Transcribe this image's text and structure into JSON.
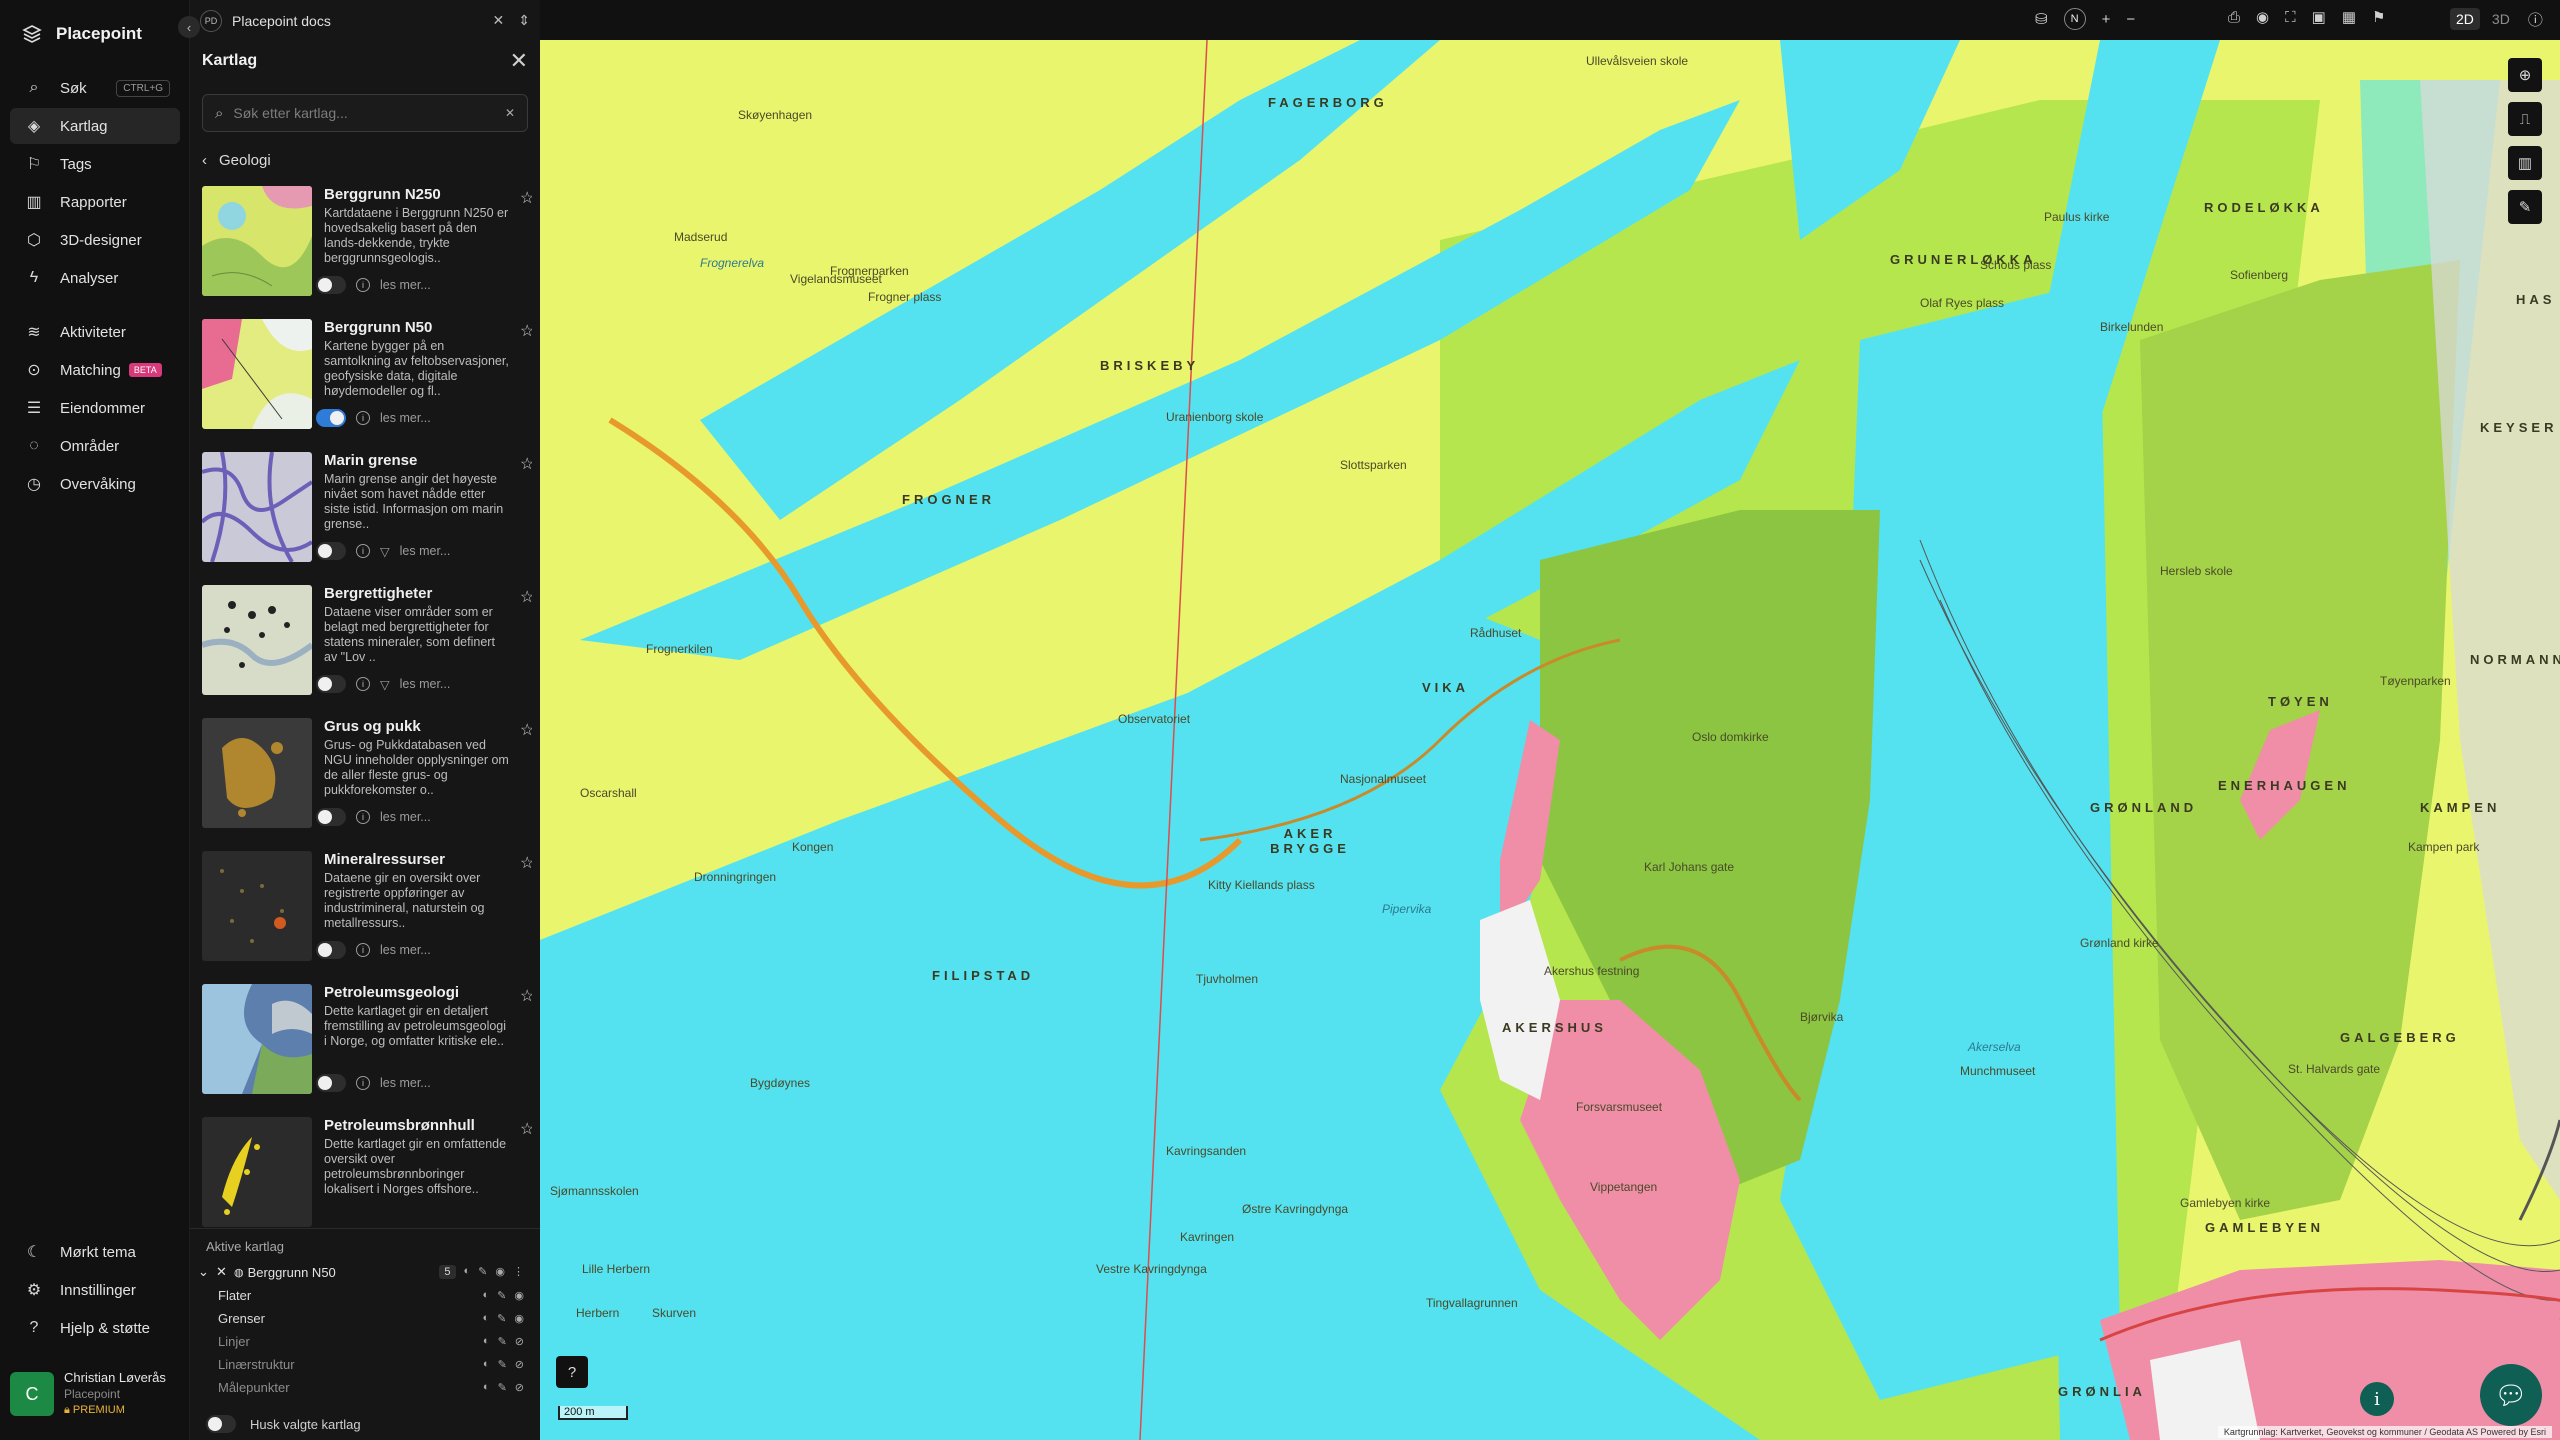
{
  "app": {
    "name": "Placepoint",
    "doc_badge": "PD",
    "doc_title": "Placepoint docs"
  },
  "nav": {
    "items": [
      {
        "label": "Søk",
        "icon": "search-icon",
        "shortcut": "CTRL+G"
      },
      {
        "label": "Kartlag",
        "icon": "layers-icon",
        "active": true
      },
      {
        "label": "Tags",
        "icon": "bookmark-icon"
      },
      {
        "label": "Rapporter",
        "icon": "chart-icon"
      },
      {
        "label": "3D-designer",
        "icon": "cube-icon"
      },
      {
        "label": "Analyser",
        "icon": "bolt-icon"
      },
      {
        "label": "Aktiviteter",
        "icon": "layers-stack-icon"
      },
      {
        "label": "Matching",
        "icon": "search-zoom-icon",
        "badge": "BETA"
      },
      {
        "label": "Eiendommer",
        "icon": "list-icon"
      },
      {
        "label": "Områder",
        "icon": "area-icon"
      },
      {
        "label": "Overvåking",
        "icon": "clock-icon"
      }
    ],
    "bottom": [
      {
        "label": "Mørkt tema",
        "icon": "moon-icon"
      },
      {
        "label": "Innstillinger",
        "icon": "gear-icon"
      },
      {
        "label": "Hjelp & støtte",
        "icon": "help-icon"
      }
    ],
    "user": {
      "initial": "C",
      "name": "Christian Løverås",
      "org": "Placepoint",
      "plan": "PREMIUM"
    }
  },
  "panel": {
    "title": "Kartlag",
    "search_placeholder": "Søk etter kartlag...",
    "breadcrumb": "Geologi",
    "read_more": "les mer...",
    "layers": [
      {
        "name": "Berggrunn N250",
        "desc": "Kartdataene i Berggrunn N250 er hovedsakelig basert på den lands-dekkende, trykte berggrunnsgeologis..",
        "on": false,
        "filter": false
      },
      {
        "name": "Berggrunn N50",
        "desc": "Kartene bygger på en samtolkning av feltobservasjoner, geofysiske data, digitale høydemodeller og fl..",
        "on": true,
        "filter": false
      },
      {
        "name": "Marin grense",
        "desc": "Marin grense angir det høyeste nivået som havet nådde etter siste istid. Informasjon om marin grense..",
        "on": false,
        "filter": true
      },
      {
        "name": "Bergrettigheter",
        "desc": "Dataene viser områder som er belagt med bergrettigheter for statens mineraler, som definert av \"Lov ..",
        "on": false,
        "filter": true
      },
      {
        "name": "Grus og pukk",
        "desc": "Grus- og Pukkdatabasen ved NGU inneholder opplysninger om de aller fleste grus- og pukkforekomster o..",
        "on": false,
        "filter": false
      },
      {
        "name": "Mineralressurser",
        "desc": "Dataene gir en oversikt over registrerte oppføringer av industrimineral, naturstein og metallressurs..",
        "on": false,
        "filter": false
      },
      {
        "name": "Petroleumsgeologi",
        "desc": "Dette kartlaget gir en detaljert fremstilling av petroleumsgeologi i Norge, og omfatter kritiske ele..",
        "on": false,
        "filter": false
      },
      {
        "name": "Petroleumsbrønnhull",
        "desc": "Dette kartlaget gir en omfattende oversikt over petroleumsbrønnboringer lokalisert i Norges offshore..",
        "on": false,
        "filter": false
      }
    ],
    "active": {
      "title": "Aktive kartlag",
      "layer_name": "Berggrunn N50",
      "count": "5",
      "sublayers": [
        {
          "name": "Flater",
          "visible": true
        },
        {
          "name": "Grenser",
          "visible": true
        },
        {
          "name": "Linjer",
          "visible": false
        },
        {
          "name": "Linærstruktur",
          "visible": false
        },
        {
          "name": "Målepunkter",
          "visible": false
        }
      ],
      "remember_label": "Husk valgte kartlag"
    }
  },
  "toolbar": {
    "compass": "N",
    "mode_2d": "2D",
    "mode_3d": "3D"
  },
  "map": {
    "scale": "200 m",
    "attribution": "Kartgrunnlag: Kartverket, Geovekst og kommuner / Geodata AS Powered by Esri",
    "districts": [
      "FAGERBORG",
      "BRISKEBY",
      "FROGNER",
      "AKER BRYGGE",
      "FILIPSTAD",
      "AKERSHUS",
      "GRUNERLØKKA",
      "RODELØKKA",
      "TØYEN",
      "ENERHAUGEN",
      "GRØNLAND",
      "GALGEBERG",
      "GAMLEBYEN",
      "KAMPEN",
      "GRØNLIA",
      "VIKA",
      "KEYSER",
      "HAS",
      "NORMANN"
    ],
    "places": [
      "Skøyenhagen",
      "Frognerparken",
      "Vigelandsmuseet",
      "Frogner plass",
      "Madserud",
      "Frognerelva",
      "Uranienborg skole",
      "Frognerkilen",
      "Oscarshall",
      "Kongen",
      "Dronningringen",
      "Bygdøynes",
      "Kavringsanden",
      "Østre Kavringdynga",
      "Vestre Kavringdynga",
      "Tingvallagrunnen",
      "Lille Herbern",
      "Herbern",
      "Skurven",
      "Kavringen",
      "Tjuvholmen",
      "Nasjonalmuseet",
      "Kitty Kiellands plass",
      "Forsvarsmuseet",
      "Vippetangen",
      "Akershus festning",
      "Oslo domkirke",
      "Akerselva",
      "Munchmuseet",
      "Bjørvika",
      "Sofienberg",
      "Olaf Ryes plass",
      "Birkelunden",
      "Tøyenparken",
      "Kampen park",
      "Grønland kirke",
      "St. Halvards gate",
      "Gamlebyen kirke",
      "Hersleb skole",
      "Ullevålsveien skole",
      "Paulus kirke",
      "Schous plass",
      "Observatoriet",
      "Slottsparken",
      "Karl Johans gate",
      "Pipervika",
      "Rådhuset",
      "Sjømannsskolen"
    ]
  },
  "colors": {
    "accent": "#2f7bd8",
    "geo_yellow": "#e9f56c",
    "geo_cyan": "#54e2f0",
    "geo_green": "#9acb4a",
    "geo_pink": "#ef8ea6",
    "premium": "#e8b23c",
    "chat": "#0f5f55"
  }
}
